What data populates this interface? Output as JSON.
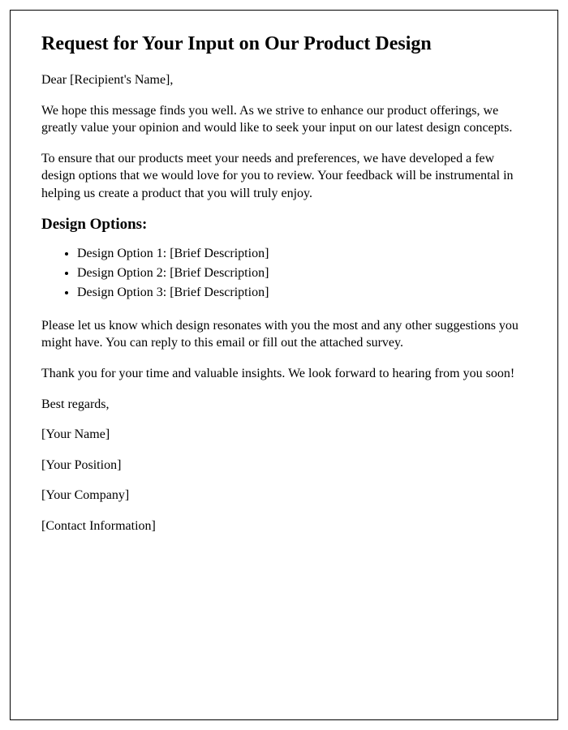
{
  "title": "Request for Your Input on Our Product Design",
  "greeting": "Dear [Recipient's Name],",
  "para1": "We hope this message finds you well. As we strive to enhance our product offerings, we greatly value your opinion and would like to seek your input on our latest design concepts.",
  "para2": "To ensure that our products meet your needs and preferences, we have developed a few design options that we would love for you to review. Your feedback will be instrumental in helping us create a product that you will truly enjoy.",
  "design_heading": "Design Options:",
  "options": [
    "Design Option 1: [Brief Description]",
    "Design Option 2: [Brief Description]",
    "Design Option 3: [Brief Description]"
  ],
  "para3": "Please let us know which design resonates with you the most and any other suggestions you might have. You can reply to this email or fill out the attached survey.",
  "para4": "Thank you for your time and valuable insights. We look forward to hearing from you soon!",
  "signoff": "Best regards,",
  "sender_name": "[Your Name]",
  "sender_position": "[Your Position]",
  "sender_company": "[Your Company]",
  "contact_info": "[Contact Information]"
}
